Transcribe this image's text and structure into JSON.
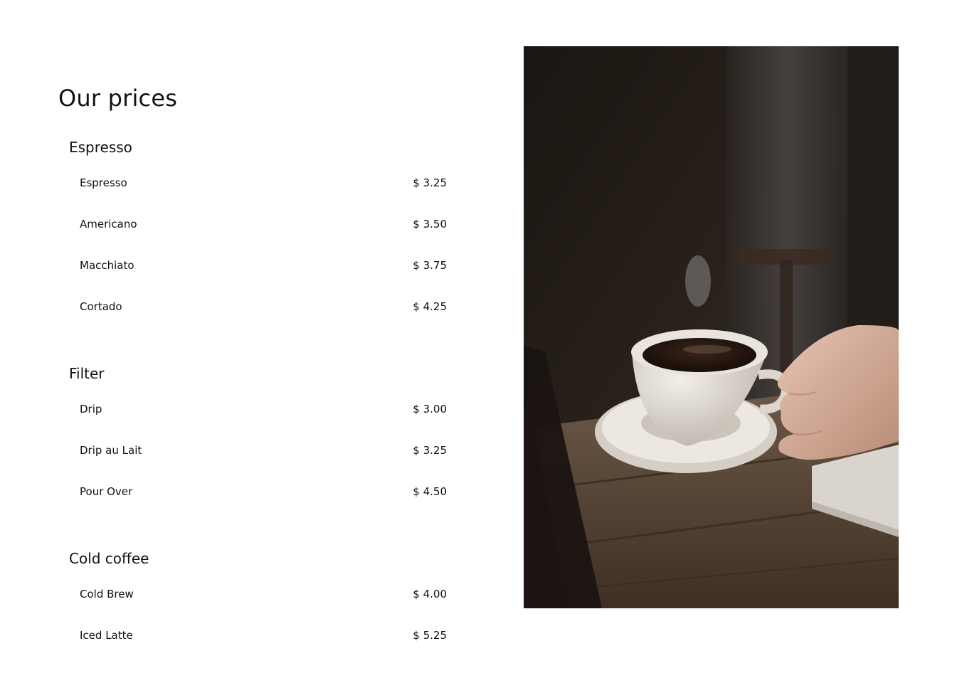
{
  "page": {
    "title": "Our prices"
  },
  "categories": [
    {
      "name": "Espresso",
      "items": [
        {
          "name": "Espresso",
          "price": "$ 3.25"
        },
        {
          "name": "Americano",
          "price": "$ 3.50"
        },
        {
          "name": "Macchiato",
          "price": "$ 3.75"
        },
        {
          "name": "Cortado",
          "price": "$ 4.25"
        }
      ]
    },
    {
      "name": "Filter",
      "items": [
        {
          "name": "Drip",
          "price": "$ 3.00"
        },
        {
          "name": "Drip au Lait",
          "price": "$ 3.25"
        },
        {
          "name": "Pour Over",
          "price": "$ 4.50"
        }
      ]
    },
    {
      "name": "Cold coffee",
      "items": [
        {
          "name": "Cold Brew",
          "price": "$ 4.00"
        },
        {
          "name": "Iced Latte",
          "price": "$ 5.25"
        }
      ]
    }
  ],
  "photo": {
    "subject": "coffee-cup-photo",
    "colors": {
      "background": "#1e1915",
      "table": "#5a4636",
      "cup": "#e4ded5",
      "coffee": "#2a1a12",
      "hand": "#d9b3a0"
    }
  }
}
